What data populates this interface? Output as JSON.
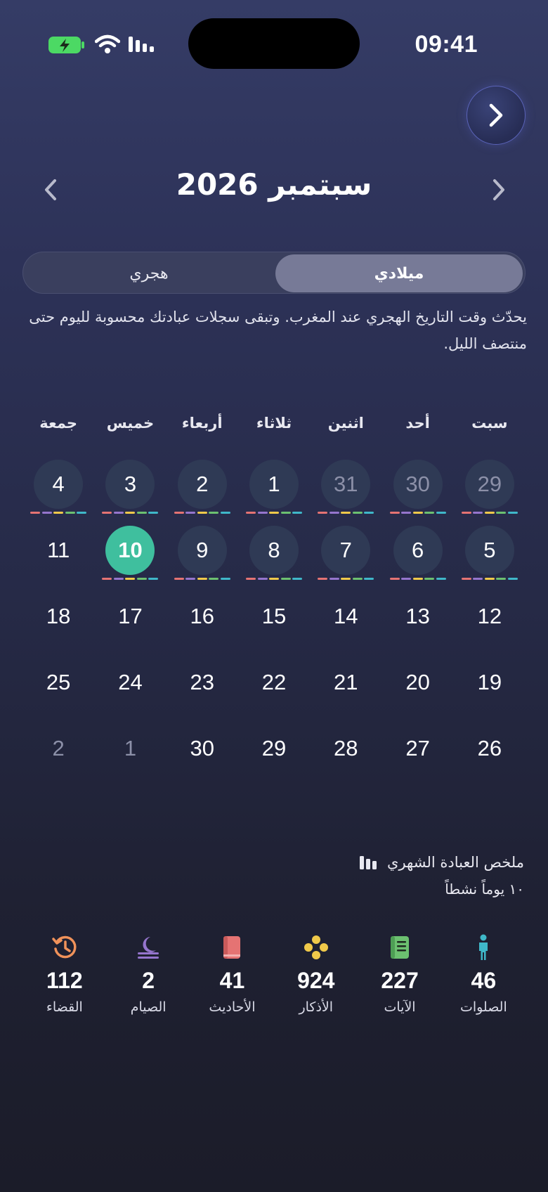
{
  "status_bar": {
    "time": "09:41"
  },
  "header": {
    "month_title": "سبتمبر 2026"
  },
  "calendar_toggle": {
    "gregorian_label": "ميلادي",
    "hijri_label": "هجري"
  },
  "note": "يحدّث وقت التاريخ الهجري عند المغرب. وتبقى سجلات عبادتك محسوبة لليوم حتى منتصف الليل.",
  "weekdays": [
    "سبت",
    "أحد",
    "اثنين",
    "ثلاثاء",
    "أربعاء",
    "خميس",
    "جمعة"
  ],
  "colors": {
    "accent_today": "#3fbf9e",
    "dash_colors": [
      "#e57373",
      "#9575cd",
      "#f0c94a",
      "#6cc070",
      "#3fb8c9"
    ]
  },
  "weeks": [
    [
      {
        "label": "29",
        "muted": true,
        "active": true
      },
      {
        "label": "30",
        "muted": true,
        "active": true
      },
      {
        "label": "31",
        "muted": true,
        "active": true
      },
      {
        "label": "1",
        "muted": false,
        "active": true
      },
      {
        "label": "2",
        "muted": false,
        "active": true
      },
      {
        "label": "3",
        "muted": false,
        "active": true
      },
      {
        "label": "4",
        "muted": false,
        "active": true
      }
    ],
    [
      {
        "label": "5",
        "muted": false,
        "active": true
      },
      {
        "label": "6",
        "muted": false,
        "active": true
      },
      {
        "label": "7",
        "muted": false,
        "active": true
      },
      {
        "label": "8",
        "muted": false,
        "active": true
      },
      {
        "label": "9",
        "muted": false,
        "active": true
      },
      {
        "label": "10",
        "muted": false,
        "active": true,
        "today": true
      },
      {
        "label": "11",
        "muted": false,
        "active": false
      }
    ],
    [
      {
        "label": "12",
        "muted": false,
        "active": false
      },
      {
        "label": "13",
        "muted": false,
        "active": false
      },
      {
        "label": "14",
        "muted": false,
        "active": false
      },
      {
        "label": "15",
        "muted": false,
        "active": false
      },
      {
        "label": "16",
        "muted": false,
        "active": false
      },
      {
        "label": "17",
        "muted": false,
        "active": false
      },
      {
        "label": "18",
        "muted": false,
        "active": false
      }
    ],
    [
      {
        "label": "19",
        "muted": false,
        "active": false
      },
      {
        "label": "20",
        "muted": false,
        "active": false
      },
      {
        "label": "21",
        "muted": false,
        "active": false
      },
      {
        "label": "22",
        "muted": false,
        "active": false
      },
      {
        "label": "23",
        "muted": false,
        "active": false
      },
      {
        "label": "24",
        "muted": false,
        "active": false
      },
      {
        "label": "25",
        "muted": false,
        "active": false
      }
    ],
    [
      {
        "label": "26",
        "muted": false,
        "active": false
      },
      {
        "label": "27",
        "muted": false,
        "active": false
      },
      {
        "label": "28",
        "muted": false,
        "active": false
      },
      {
        "label": "29",
        "muted": false,
        "active": false
      },
      {
        "label": "30",
        "muted": false,
        "active": false
      },
      {
        "label": "1",
        "muted": true,
        "active": false
      },
      {
        "label": "2",
        "muted": true,
        "active": false
      }
    ]
  ],
  "summary": {
    "title": "ملخص العبادة الشهري",
    "active_days": "١٠ يوماً نشطاً",
    "stats": [
      {
        "icon": "person-icon",
        "color": "#3fb8c9",
        "value": "46",
        "label": "الصلوات"
      },
      {
        "icon": "book-green-icon",
        "color": "#6cc070",
        "value": "227",
        "label": "الآيات"
      },
      {
        "icon": "beads-icon",
        "color": "#f0c94a",
        "value": "924",
        "label": "الأذكار"
      },
      {
        "icon": "book-red-icon",
        "color": "#e57373",
        "value": "41",
        "label": "الأحاديث"
      },
      {
        "icon": "moon-icon",
        "color": "#9575cd",
        "value": "2",
        "label": "الصيام"
      },
      {
        "icon": "history-icon",
        "color": "#f0925a",
        "value": "112",
        "label": "القضاء"
      }
    ]
  }
}
